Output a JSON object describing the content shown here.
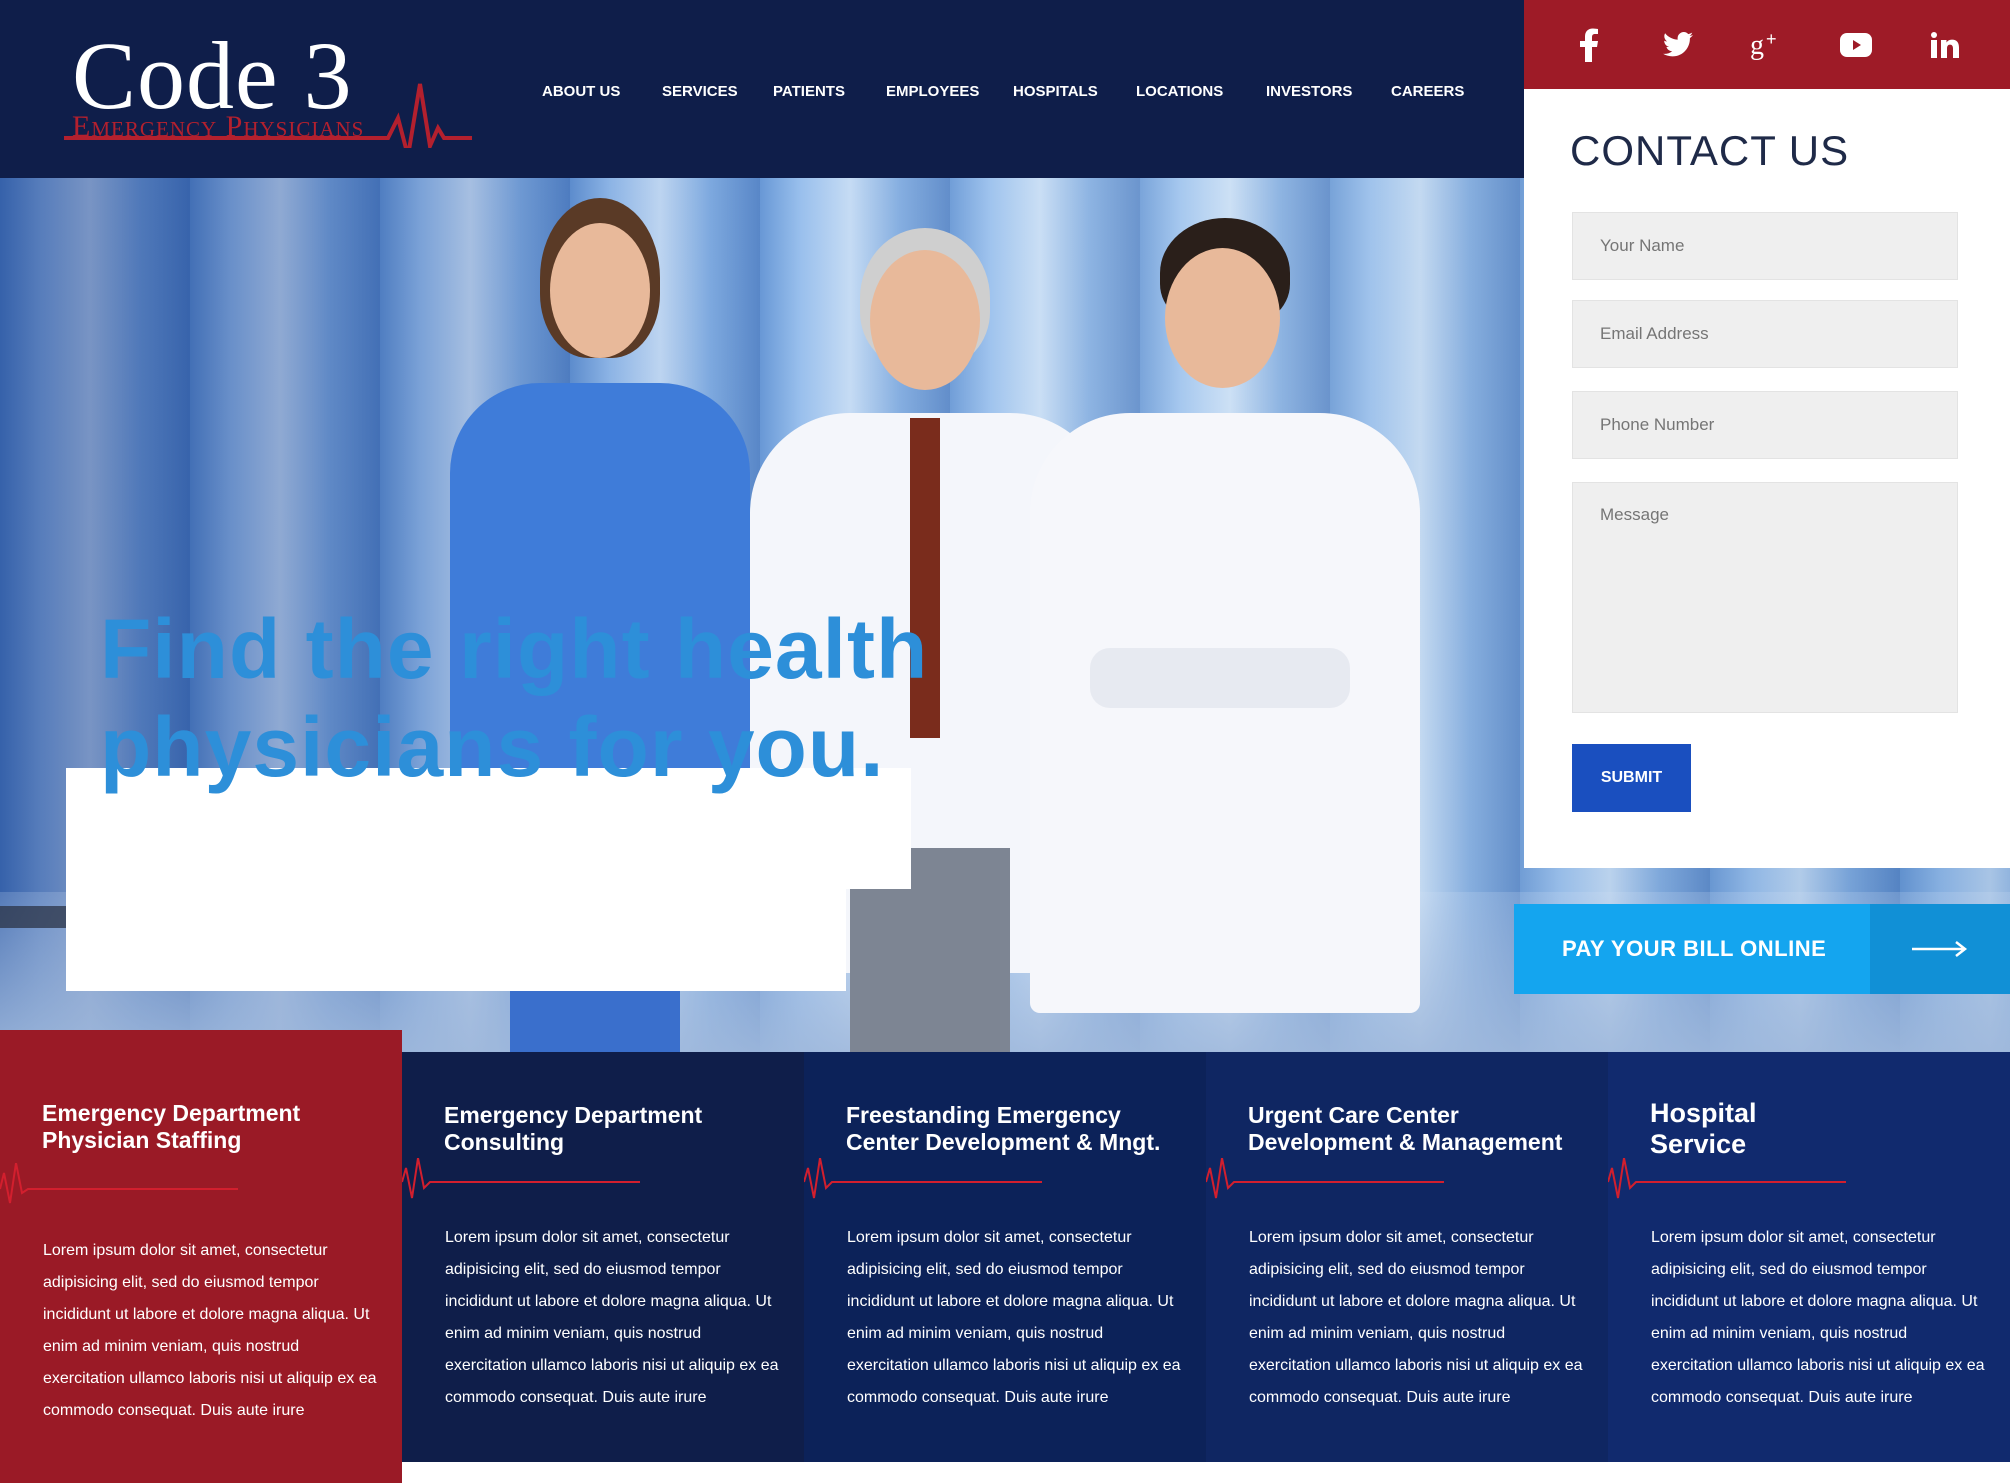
{
  "brand": {
    "name": "Code 3",
    "tagline": "Emergency Physicians"
  },
  "nav": {
    "items": [
      "ABOUT US",
      "SERVICES",
      "PATIENTS",
      "EMPLOYEES",
      "HOSPITALS",
      "LOCATIONS",
      "INVESTORS",
      "CAREERS"
    ]
  },
  "social": [
    "facebook-icon",
    "twitter-icon",
    "google-plus-icon",
    "youtube-icon",
    "linkedin-icon"
  ],
  "hero": {
    "line1": "Find the right health",
    "line2": "physicians for you."
  },
  "contact": {
    "title": "CONTACT US",
    "name_placeholder": "Your Name",
    "email_placeholder": "Email Address",
    "phone_placeholder": "Phone Number",
    "message_placeholder": "Message",
    "submit_label": "SUBMIT"
  },
  "paybill": {
    "label": "PAY YOUR BILL ONLINE"
  },
  "services": [
    {
      "title1": "Emergency Department",
      "title2": "Physician Staffing",
      "body": "Lorem ipsum dolor sit amet, consectetur adipisicing elit, sed do eiusmod tempor incididunt ut labore et dolore magna aliqua. Ut enim ad minim veniam, quis nostrud exercitation ullamco laboris nisi ut aliquip ex ea commodo consequat. Duis aute irure"
    },
    {
      "title1": "Emergency Department",
      "title2": "Consulting",
      "body": "Lorem ipsum dolor sit amet, consectetur adipisicing elit, sed do eiusmod tempor incididunt ut labore et dolore magna aliqua. Ut enim ad minim veniam, quis nostrud exercitation ullamco laboris nisi ut aliquip ex ea commodo consequat. Duis aute irure"
    },
    {
      "title1": "Freestanding Emergency",
      "title2": "Center Development & Mngt.",
      "body": "Lorem ipsum dolor sit amet, consectetur adipisicing elit, sed do eiusmod tempor incididunt ut labore et dolore magna aliqua. Ut enim ad minim veniam, quis nostrud exercitation ullamco laboris nisi ut aliquip ex ea commodo consequat. Duis aute irure"
    },
    {
      "title1": "Urgent Care Center",
      "title2": "Development & Management",
      "body": "Lorem ipsum dolor sit amet, consectetur adipisicing elit, sed do eiusmod tempor incididunt ut labore et dolore magna aliqua. Ut enim ad minim veniam, quis nostrud exercitation ullamco laboris nisi ut aliquip ex ea commodo consequat. Duis aute irure"
    },
    {
      "title1": "Hospital",
      "title2": "Service",
      "body": "Lorem ipsum dolor sit amet, consectetur adipisicing elit, sed do eiusmod tempor incididunt ut labore et dolore magna aliqua. Ut enim ad minim veniam, quis nostrud exercitation ullamco laboris nisi ut aliquip ex ea commodo consequat. Duis aute irure"
    }
  ],
  "colors": {
    "navy": "#0f1e4a",
    "red": "#9e1b27",
    "blue_text": "#2d8fd9",
    "submit_blue": "#1a4fbf",
    "paybill_blue": "#14a5ef"
  }
}
